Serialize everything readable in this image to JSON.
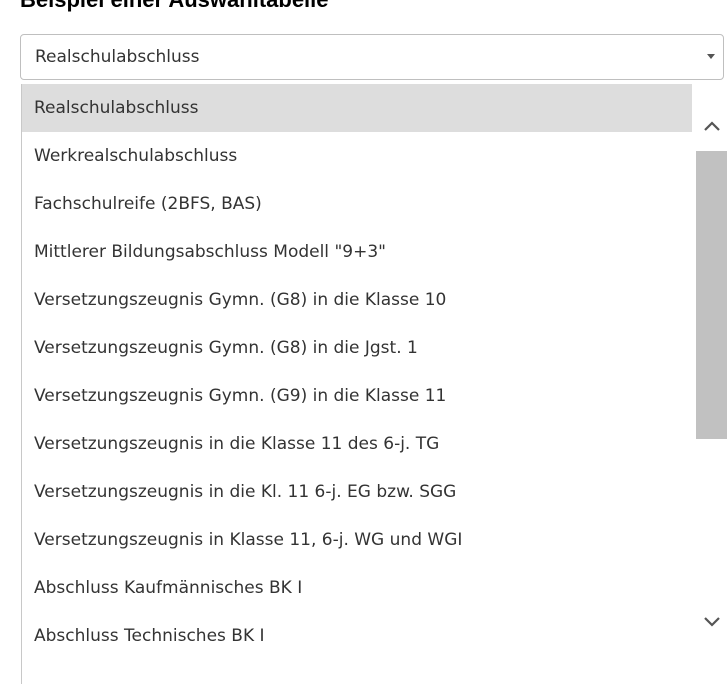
{
  "heading": "Beispiel einer Auswahltabelle",
  "select": {
    "value": "Realschulabschluss",
    "icon": "caret-down-icon"
  },
  "options": [
    "Realschulabschluss",
    "Werkrealschulabschluss",
    "Fachschulreife (2BFS, BAS)",
    "Mittlerer Bildungsabschluss Modell  \"9+3\"",
    "Versetzungszeugnis Gymn. (G8) in die Klasse 10",
    "Versetzungszeugnis Gymn. (G8) in die Jgst. 1",
    "Versetzungszeugnis Gymn. (G9) in die Klasse 11",
    "Versetzungszeugnis in die Klasse 11 des 6-j. TG",
    "Versetzungszeugnis in die Kl. 11 6-j. EG bzw. SGG",
    "Versetzungszeugnis in Klasse 11, 6-j. WG und WGI",
    "Abschluss Kaufmännisches BK I",
    "Abschluss Technisches BK I"
  ],
  "selected_index": 0,
  "scrollbar": {
    "up_icon": "chevron-up-icon",
    "down_icon": "chevron-down-icon"
  }
}
